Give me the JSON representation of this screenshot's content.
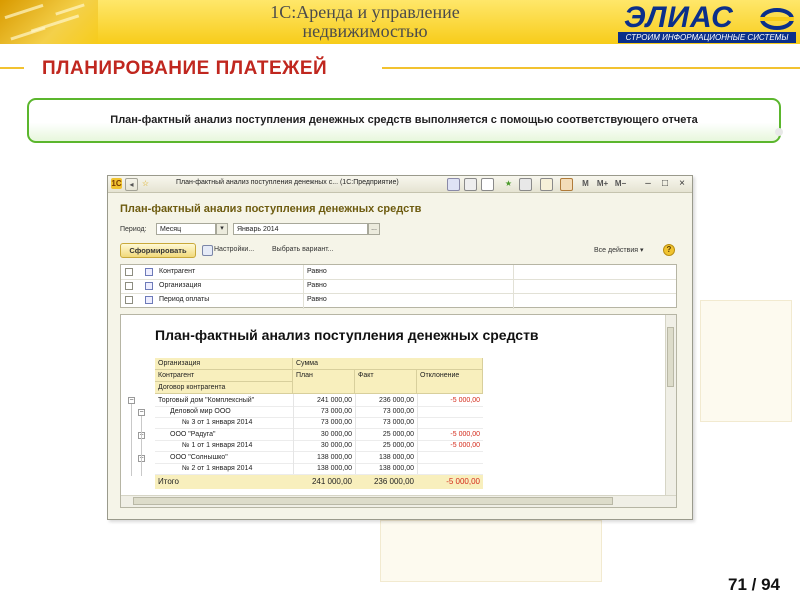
{
  "slide": {
    "app_title": "1С:Аренда и управление недвижимостью",
    "logo_word": "ЭЛИАС",
    "logo_tagline": "СТРОИМ ИНФОРМАЦИОННЫЕ СИСТЕМЫ",
    "section_title": "ПЛАНИРОВАНИЕ ПЛАТЕЖЕЙ",
    "description": "План-фактный анализ поступления денежных средств выполняется с помощью соответствующего отчета",
    "page_number": "71 / 94",
    "colors": {
      "accent_yellow": "#f7cc1a",
      "title_red": "#c0271f",
      "box_green": "#5bb62d",
      "logo_blue": "#0b2f8a"
    }
  },
  "window": {
    "title": "План-фактный анализ поступления денежных с...  (1С:Предприятие)",
    "toolbar_icons": [
      "save-icon",
      "print-icon",
      "preview-icon",
      "favorites-icon",
      "calculator-icon",
      "calendar-icon",
      "clipboard-icon",
      "memory-icon"
    ],
    "toolbar_text": {
      "m": "M",
      "m_plus": "M+",
      "m_minus": "M−"
    },
    "controls": {
      "minimize": "–",
      "maximize": "□",
      "close": "×"
    },
    "report_title": "План-фактный анализ поступления денежных средств",
    "period_label": "Период:",
    "period_type": "Месяц",
    "period_value": "Январь 2014",
    "period_select": "...",
    "generate_button": "Сформировать",
    "settings_button": "Настройки...",
    "variant_button": "Выбрать вариант...",
    "all_actions": "Все действия ▾",
    "help": "?",
    "filters": [
      {
        "field": "Контрагент",
        "condition": "Равно"
      },
      {
        "field": "Организация",
        "condition": "Равно"
      },
      {
        "field": "Период оплаты",
        "condition": "Равно"
      }
    ]
  },
  "report": {
    "heading": "План-фактный анализ поступления денежных средств",
    "headers": {
      "org": "Организация",
      "counterparty": "Контрагент",
      "contract": "Договор контрагента",
      "sum": "Сумма",
      "plan": "План",
      "fact": "Факт",
      "deviation": "Отклонение"
    },
    "rows": [
      {
        "name": "Торговый дом \"Комплексный\"",
        "plan": "241 000,00",
        "fact": "236 000,00",
        "dev": "-5 000,00"
      },
      {
        "name": "Деловой мир ООО",
        "plan": "73 000,00",
        "fact": "73 000,00",
        "dev": ""
      },
      {
        "name": "№ 3 от 1 января 2014",
        "plan": "73 000,00",
        "fact": "73 000,00",
        "dev": ""
      },
      {
        "name": "ООО \"Радуга\"",
        "plan": "30 000,00",
        "fact": "25 000,00",
        "dev": "-5 000,00"
      },
      {
        "name": "№ 1 от 1 января 2014",
        "plan": "30 000,00",
        "fact": "25 000,00",
        "dev": "-5 000,00"
      },
      {
        "name": "ООО \"Солнышко\"",
        "plan": "138 000,00",
        "fact": "138 000,00",
        "dev": ""
      },
      {
        "name": "№ 2 от 1 января 2014",
        "plan": "138 000,00",
        "fact": "138 000,00",
        "dev": ""
      }
    ],
    "total": {
      "label": "Итого",
      "plan": "241 000,00",
      "fact": "236 000,00",
      "dev": "-5 000,00"
    },
    "tree_expanders": [
      "−",
      "−",
      "−",
      "−"
    ]
  }
}
